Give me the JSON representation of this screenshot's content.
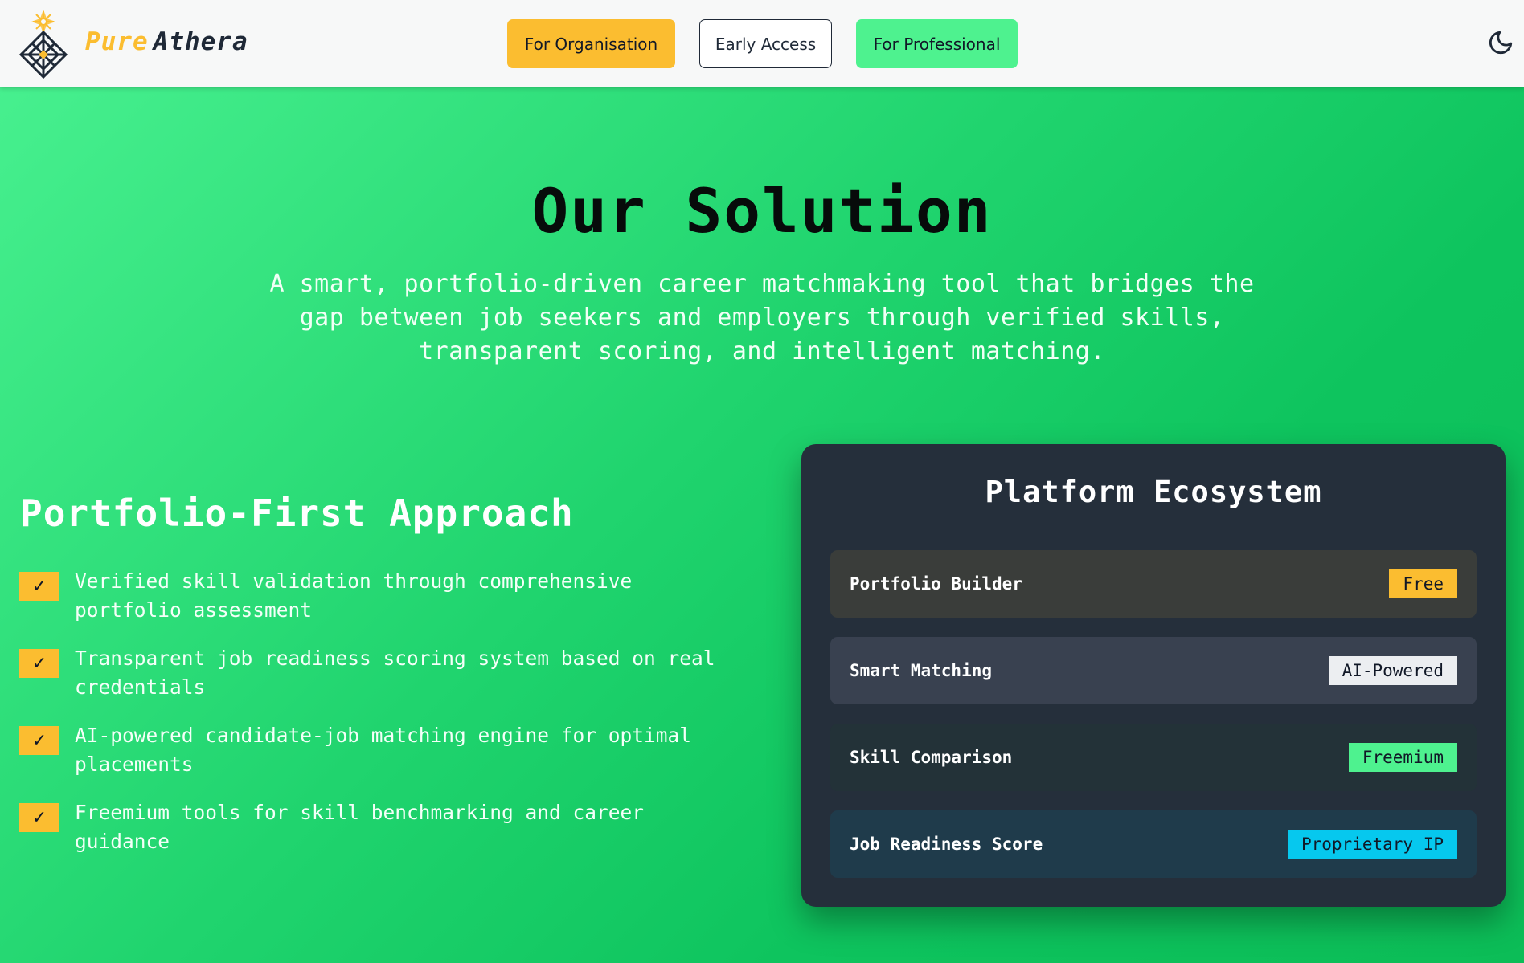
{
  "header": {
    "brand_first": "Pure",
    "brand_second": "Athera",
    "nav": {
      "organisation": "For Organisation",
      "early_access": "Early Access",
      "professional": "For Professional"
    },
    "theme_icon": "moon-icon"
  },
  "hero": {
    "title": "Our Solution",
    "subtitle": "A smart, portfolio-driven career matchmaking tool that bridges the gap between job seekers and employers through verified skills, transparent scoring, and intelligent matching."
  },
  "approach": {
    "title": "Portfolio-First Approach",
    "check_glyph": "✓",
    "items": [
      "Verified skill validation through comprehensive portfolio assessment",
      "Transparent job readiness scoring system based on real credentials",
      "AI-powered candidate-job matching engine for optimal placements",
      "Freemium tools for skill benchmarking and career guidance"
    ]
  },
  "ecosystem": {
    "title": "Platform Ecosystem",
    "items": [
      {
        "label": "Portfolio Builder",
        "badge": "Free",
        "badge_color": "#fbbd30"
      },
      {
        "label": "Smart Matching",
        "badge": "AI-Powered",
        "badge_color": "#eceef1"
      },
      {
        "label": "Skill Comparison",
        "badge": "Freemium",
        "badge_color": "#4ef28f"
      },
      {
        "label": "Job Readiness Score",
        "badge": "Proprietary IP",
        "badge_color": "#06c8ee"
      }
    ]
  },
  "colors": {
    "accent_yellow": "#fbbd30",
    "accent_green": "#4ef28f",
    "panel_bg": "#252f3b"
  }
}
